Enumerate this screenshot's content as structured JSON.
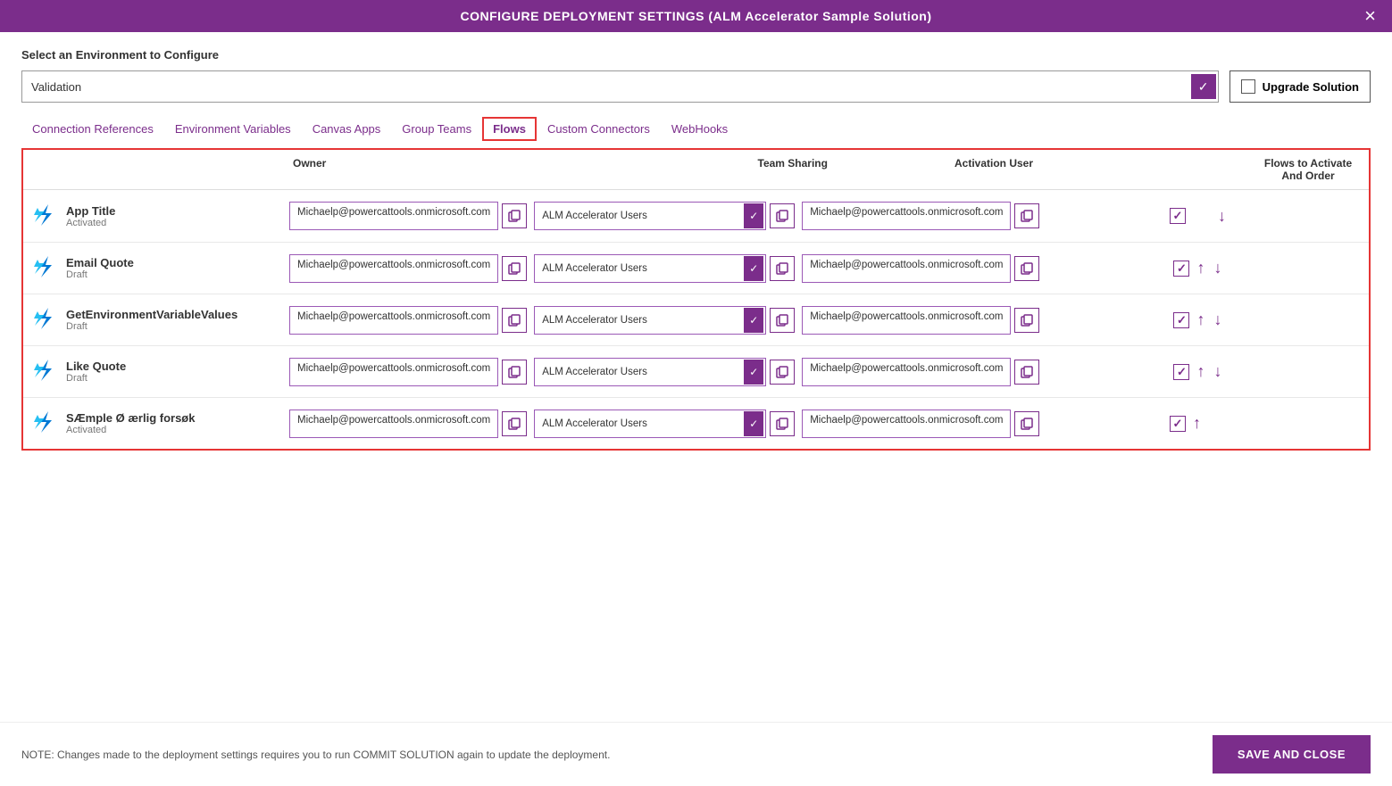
{
  "dialog": {
    "title": "CONFIGURE DEPLOYMENT SETTINGS (ALM Accelerator Sample Solution)",
    "close_label": "×"
  },
  "environment": {
    "label": "Select an Environment to Configure",
    "selected": "Validation",
    "upgrade_label": "Upgrade Solution"
  },
  "tabs": [
    {
      "id": "connection-references",
      "label": "Connection References",
      "active": false
    },
    {
      "id": "environment-variables",
      "label": "Environment Variables",
      "active": false
    },
    {
      "id": "canvas-apps",
      "label": "Canvas Apps",
      "active": false
    },
    {
      "id": "group-teams",
      "label": "Group Teams",
      "active": false
    },
    {
      "id": "flows",
      "label": "Flows",
      "active": true
    },
    {
      "id": "custom-connectors",
      "label": "Custom Connectors",
      "active": false
    },
    {
      "id": "webhooks",
      "label": "WebHooks",
      "active": false
    }
  ],
  "table": {
    "headers": {
      "col1": "",
      "owner": "Owner",
      "col3": "",
      "team_sharing": "Team Sharing",
      "col5": "",
      "activation_user": "Activation User",
      "flows_order": "Flows to Activate\nAnd Order"
    },
    "rows": [
      {
        "name": "App Title",
        "status": "Activated",
        "owner": "Michaelp@powercattools.onmicrosoft.com",
        "team": "ALM Accelerator Users",
        "activation_user": "Michaelp@powercattools.onmicrosoft.com",
        "checked": true,
        "has_up": false,
        "has_down": true
      },
      {
        "name": "Email Quote",
        "status": "Draft",
        "owner": "Michaelp@powercattools.onmicrosoft.com",
        "team": "ALM Accelerator Users",
        "activation_user": "Michaelp@powercattools.onmicrosoft.com",
        "checked": true,
        "has_up": true,
        "has_down": true
      },
      {
        "name": "GetEnvironmentVariableValues",
        "status": "Draft",
        "owner": "Michaelp@powercattools.onmicrosoft.com",
        "team": "ALM Accelerator Users",
        "activation_user": "Michaelp@powercattools.onmicrosoft.com",
        "checked": true,
        "has_up": true,
        "has_down": true
      },
      {
        "name": "Like Quote",
        "status": "Draft",
        "owner": "Michaelp@powercattools.onmicrosoft.com",
        "team": "ALM Accelerator Users",
        "activation_user": "Michaelp@powercattools.onmicrosoft.com",
        "checked": true,
        "has_up": true,
        "has_down": true
      },
      {
        "name": "SÆmple Ø ærlig forsøk",
        "status": "Activated",
        "owner": "Michaelp@powercattools.onmicrosoft.com",
        "team": "ALM Accelerator Users",
        "activation_user": "Michaelp@powercattools.onmicrosoft.com",
        "checked": true,
        "has_up": true,
        "has_down": false
      }
    ]
  },
  "footer": {
    "note": "NOTE: Changes made to the deployment settings requires you to run COMMIT SOLUTION again to update the deployment.",
    "save_close": "SAVE AND CLOSE"
  }
}
